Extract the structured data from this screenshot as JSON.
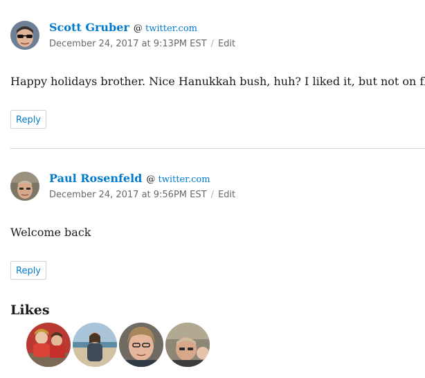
{
  "comments": [
    {
      "author": "Scott Gruber",
      "via_prefix": "@",
      "via_link": "twitter.com",
      "timestamp": "December 24, 2017 at 9:13PM EST",
      "separator": "/",
      "edit_label": "Edit",
      "text": "Happy holidays brother. Nice Hanukkah bush, huh? I liked it, but not on fb.",
      "reply_label": "Reply"
    },
    {
      "author": "Paul Rosenfeld",
      "via_prefix": "@",
      "via_link": "twitter.com",
      "timestamp": "December 24, 2017 at 9:56PM EST",
      "separator": "/",
      "edit_label": "Edit",
      "text": "Welcome back",
      "reply_label": "Reply"
    }
  ],
  "likes": {
    "title": "Likes",
    "count": 4
  },
  "colors": {
    "link": "#007acc",
    "meta": "#686868",
    "border": "#d1d1d1"
  }
}
